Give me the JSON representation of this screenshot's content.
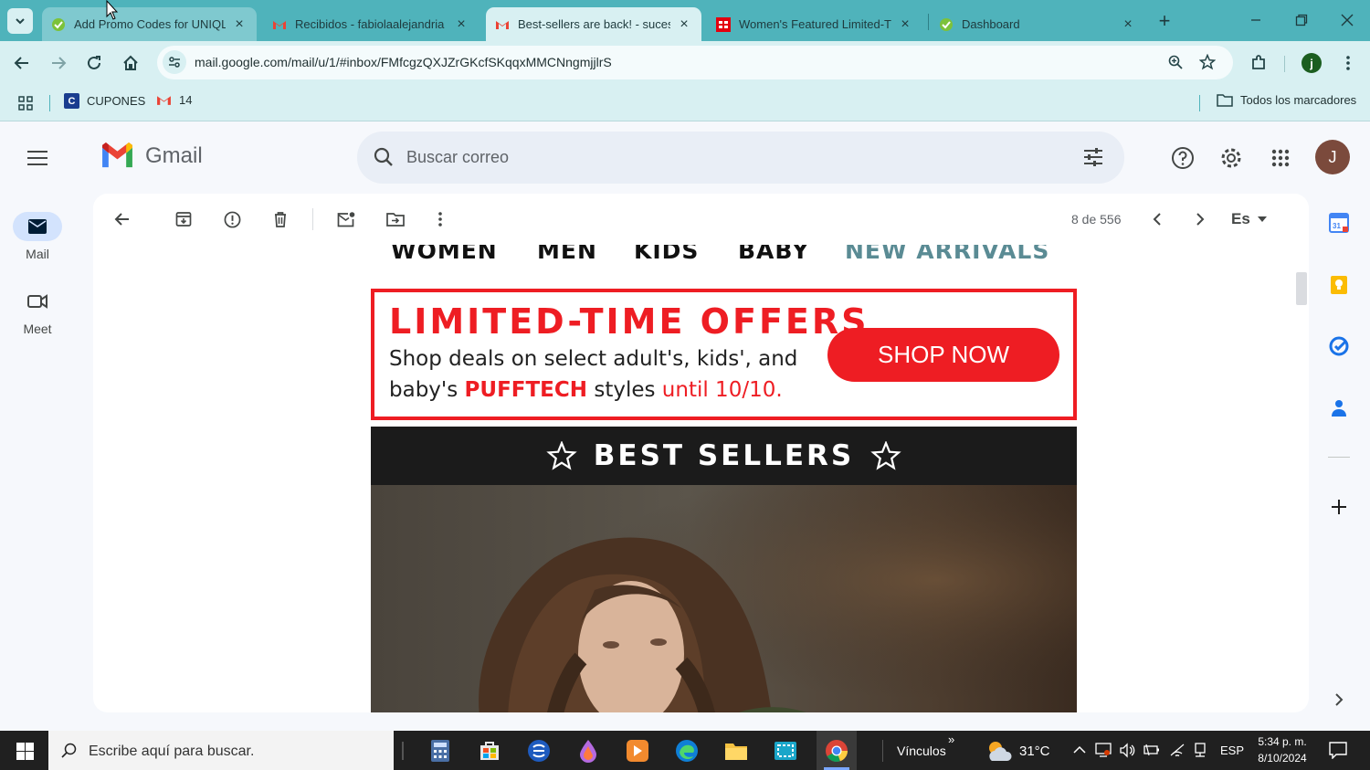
{
  "browser": {
    "tabs": [
      {
        "title": "Add Promo Codes for UNIQLO",
        "active": false
      },
      {
        "title": "Recibidos - fabiolaalejandria",
        "active": false
      },
      {
        "title": "Best-sellers are back! - sucesos",
        "active": true
      },
      {
        "title": "Women's Featured Limited-Time",
        "active": false
      },
      {
        "title": "Dashboard",
        "active": false
      }
    ],
    "url": "mail.google.com/mail/u/1/#inbox/FMfcgzQXJZrGKcfSKqqxMMCNngmjjlrS",
    "profile_initial": "j",
    "bookmarks": [
      {
        "label": "CUPONES"
      },
      {
        "label": "14"
      }
    ],
    "all_bookmarks_label": "Todos los marcadores"
  },
  "gmail": {
    "brand": "Gmail",
    "search_placeholder": "Buscar correo",
    "account_initial": "J",
    "rail": {
      "mail_label": "Mail",
      "meet_label": "Meet"
    },
    "toolbar": {
      "pagination": "8 de 556",
      "language": "Es"
    },
    "calendar_day": "31"
  },
  "email": {
    "nav": [
      "WOMEN",
      "MEN",
      "KIDS",
      "BABY",
      "NEW ARRIVALS"
    ],
    "promo": {
      "headline": "LIMITED-TIME OFFERS",
      "line1": "Shop deals on select adult's, kids', and",
      "line2_prefix": "baby's ",
      "line2_brand": "PUFFTECH",
      "line2_mid": " styles ",
      "line2_date": "until 10/10.",
      "cta": "SHOP NOW"
    },
    "best_sellers": "BEST SELLERS"
  },
  "taskbar": {
    "search_placeholder": "Escribe aquí para buscar.",
    "links_label": "Vínculos",
    "temperature": "31°C",
    "language": "ESP",
    "time": "5:34 p. m.",
    "date": "8/10/2024"
  },
  "colors": {
    "tab_strip": "#4fb3bb",
    "toolbar": "#d8f0f2",
    "uniqlo_red": "#ee1d23",
    "new_arrivals": "#5a8b94"
  }
}
